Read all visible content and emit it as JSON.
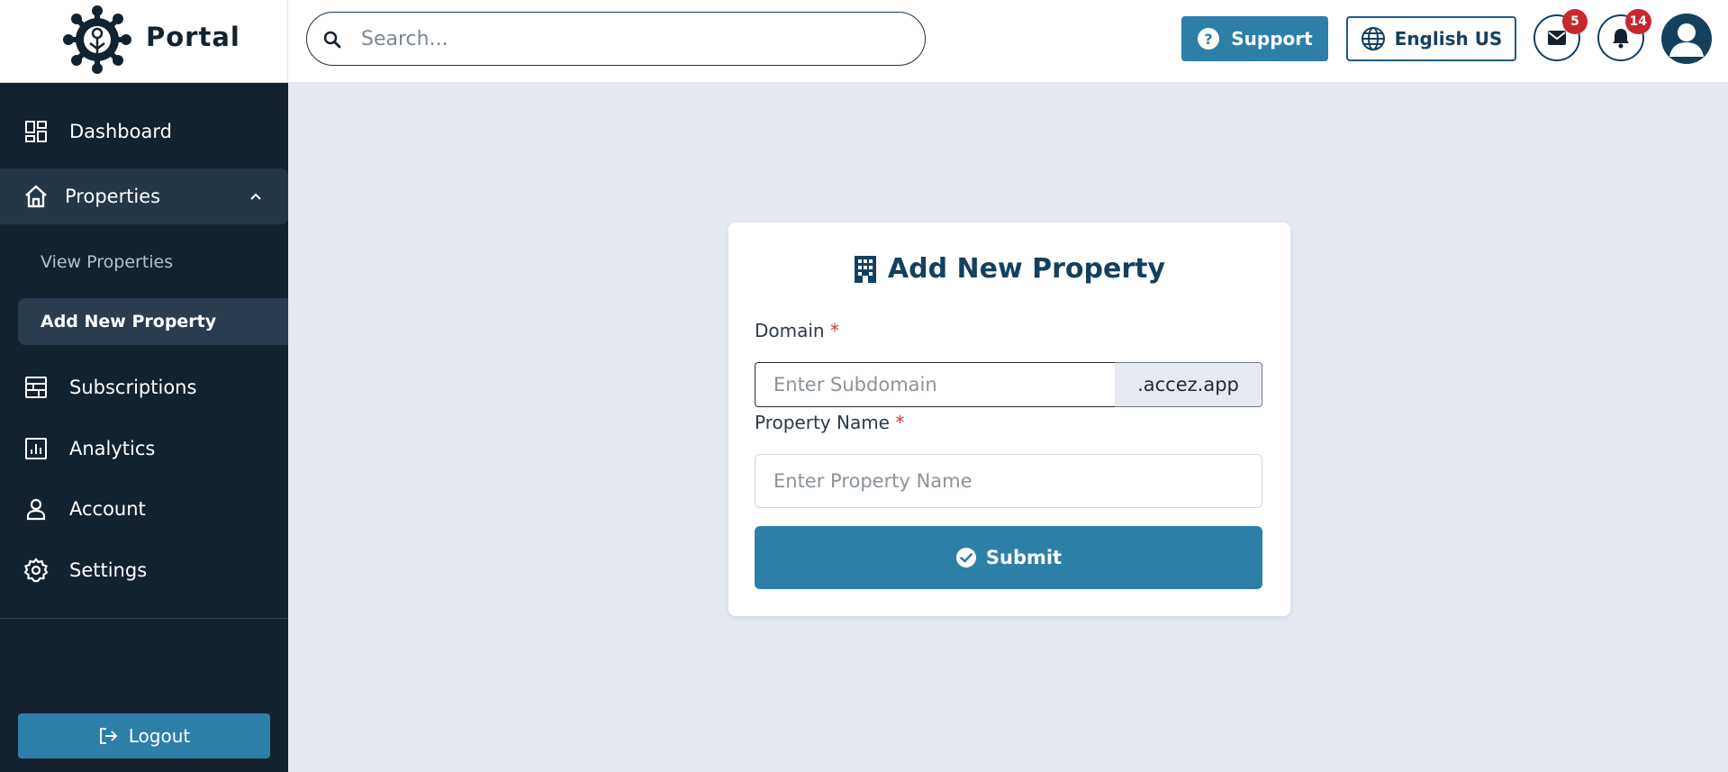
{
  "brand": {
    "name": "Portal",
    "logo_icon": "gear-network-logo"
  },
  "search": {
    "placeholder": "Search...",
    "icon": "search-icon"
  },
  "header": {
    "support_label": "Support",
    "language_label": "English US",
    "mail_badge": "5",
    "notification_badge": "14"
  },
  "sidebar": {
    "items": [
      {
        "label": "Dashboard",
        "icon": "dashboard-icon"
      },
      {
        "label": "Properties",
        "icon": "home-icon",
        "expanded": true,
        "subitems": [
          {
            "label": "View Properties"
          },
          {
            "label": "Add New Property",
            "active": true
          }
        ]
      },
      {
        "label": "Subscriptions",
        "icon": "subscriptions-icon"
      },
      {
        "label": "Analytics",
        "icon": "analytics-icon"
      },
      {
        "label": "Account",
        "icon": "account-icon"
      },
      {
        "label": "Settings",
        "icon": "settings-icon"
      }
    ],
    "logout_label": "Logout"
  },
  "form": {
    "title": "Add New Property",
    "domain_label": "Domain",
    "domain_placeholder": "Enter Subdomain",
    "domain_suffix": ".accez.app",
    "name_label": "Property Name",
    "name_placeholder": "Enter Property Name",
    "required_mark": "*",
    "submit_label": "Submit"
  },
  "colors": {
    "sidebar_bg": "#13222f",
    "accent": "#2d7fa8",
    "title_color": "#14405f",
    "badge": "#c7282c",
    "page_bg": "#e4e8f0"
  }
}
